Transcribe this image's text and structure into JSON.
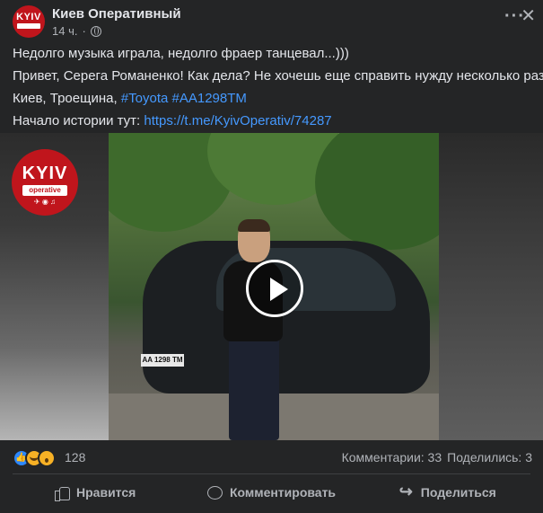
{
  "post": {
    "page_name": "Киев Оперативный",
    "time": "14 ч.",
    "avatar_text": "KYIV",
    "more_glyph": "···",
    "close_glyph": "✕",
    "lines": {
      "line1": "Недолго музыка играла, недолго фраер танцевал...)))",
      "line2": "Привет, Серега Романенко! Как дела? Не хочешь еще справить нужду несколько раз?",
      "line3_prefix": "Киев, Троещина, ",
      "line3_tag1": "#Toyota",
      "line3_tag2": "#AA1298TM",
      "line4_prefix": "Начало истории тут: ",
      "line4_link": "https://t.me/KyivOperativ/74287"
    }
  },
  "media": {
    "watermark_title": "KYIV",
    "watermark_sub": "operative",
    "plate": "AA 1298 TM"
  },
  "stats": {
    "reaction_count": "128",
    "comments": "Комментарии: 33",
    "shares": "Поделились: 3"
  },
  "actions": {
    "like": "Нравится",
    "comment": "Комментировать",
    "share": "Поделиться"
  },
  "colors": {
    "background": "#242526",
    "link": "#4599ff",
    "brand_red": "#c0151c"
  },
  "icons": [
    "globe-icon",
    "more-icon",
    "close-icon",
    "play-icon",
    "thumb-up-icon",
    "comment-icon",
    "share-icon"
  ]
}
